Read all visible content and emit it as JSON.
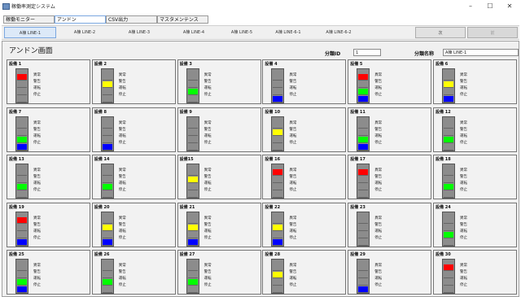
{
  "window": {
    "title": "稼働率測定システム",
    "minimize": "–",
    "maximize": "☐",
    "close": "✕"
  },
  "menu": [
    "稼働モニター",
    "アンドン",
    "CSV出力",
    "マスタメンテンス"
  ],
  "lines": [
    "A棟 LINE-1",
    "A棟 LINE-2",
    "A棟 LINE-3",
    "A棟 LINE-4",
    "A棟 LINE-5",
    "A棟 LINE-6-1",
    "A棟 LINE-6-2"
  ],
  "nav": {
    "next": "次",
    "prev": "前"
  },
  "screen": {
    "title": "アンドン画面",
    "category_id_label": "分類ID",
    "category_id": "1",
    "category_name_label": "分類名称",
    "category_name": "A棟 LINE-1"
  },
  "status_labels": [
    "異常",
    "警告",
    "運転",
    "停止"
  ],
  "colors": {
    "異常": "#ff0000",
    "警告": "#ffff00",
    "運転": "#00ff00",
    "停止": "#0000ff",
    "off": "#8c8c8c"
  },
  "equipment": [
    {
      "name": "設備 1",
      "lit": [
        0
      ]
    },
    {
      "name": "設備 2",
      "lit": [
        1
      ]
    },
    {
      "name": "設備 3",
      "lit": [
        2
      ]
    },
    {
      "name": "設備 4",
      "lit": [
        3
      ]
    },
    {
      "name": "設備 5",
      "lit": [
        0,
        2,
        3
      ]
    },
    {
      "name": "設備 6",
      "lit": [
        1,
        3
      ]
    },
    {
      "name": "設備 7",
      "lit": [
        2,
        3
      ]
    },
    {
      "name": "設備 8",
      "lit": [
        3
      ]
    },
    {
      "name": "設備 9",
      "lit": []
    },
    {
      "name": "設備 10",
      "lit": [
        1
      ]
    },
    {
      "name": "設備 11",
      "lit": [
        2,
        3
      ]
    },
    {
      "name": "設備 12",
      "lit": [
        2
      ]
    },
    {
      "name": "設備 13",
      "lit": [
        2
      ]
    },
    {
      "name": "設備 14",
      "lit": [
        2
      ]
    },
    {
      "name": "設備15",
      "lit": [
        1
      ]
    },
    {
      "name": "設備 16",
      "lit": [
        0
      ]
    },
    {
      "name": "設備 17",
      "lit": [
        0
      ]
    },
    {
      "name": "設備 18",
      "lit": [
        2
      ]
    },
    {
      "name": "設備 19",
      "lit": [
        0,
        3
      ]
    },
    {
      "name": "設備 20",
      "lit": [
        1,
        3
      ]
    },
    {
      "name": "設備 21",
      "lit": [
        1,
        3
      ]
    },
    {
      "name": "設備 22",
      "lit": [
        1,
        3
      ]
    },
    {
      "name": "設備 23",
      "lit": []
    },
    {
      "name": "設備 24",
      "lit": [
        2
      ]
    },
    {
      "name": "設備 25",
      "lit": [
        2,
        3
      ]
    },
    {
      "name": "設備 26",
      "lit": [
        2
      ]
    },
    {
      "name": "設備 27",
      "lit": [
        2
      ]
    },
    {
      "name": "設備 28",
      "lit": [
        1
      ]
    },
    {
      "name": "設備 29",
      "lit": [
        3
      ]
    },
    {
      "name": "設備 30",
      "lit": [
        0
      ]
    }
  ]
}
